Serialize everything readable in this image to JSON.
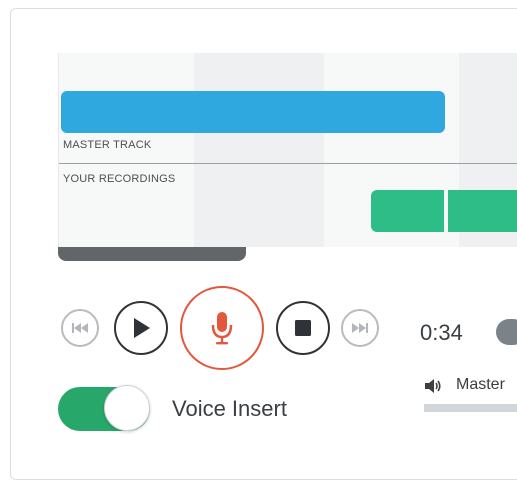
{
  "colors": {
    "master_track": "#2fa7df",
    "recording_clip": "#2ebd86",
    "record_accent": "#e2583e",
    "toggle_on": "#27a86a"
  },
  "tracks": {
    "master_label": "MASTER TRACK",
    "recordings_label": "YOUR RECORDINGS"
  },
  "transport": {
    "time": "0:34",
    "buttons": [
      {
        "name": "skip-back",
        "icon": "skip-back-icon"
      },
      {
        "name": "play",
        "icon": "play-icon"
      },
      {
        "name": "record",
        "icon": "microphone-icon"
      },
      {
        "name": "stop",
        "icon": "stop-icon"
      },
      {
        "name": "skip-forward",
        "icon": "skip-forward-icon"
      }
    ]
  },
  "voice_insert": {
    "label": "Voice Insert",
    "enabled": true
  },
  "volume": {
    "icon": "speaker-icon",
    "label": "Master"
  }
}
